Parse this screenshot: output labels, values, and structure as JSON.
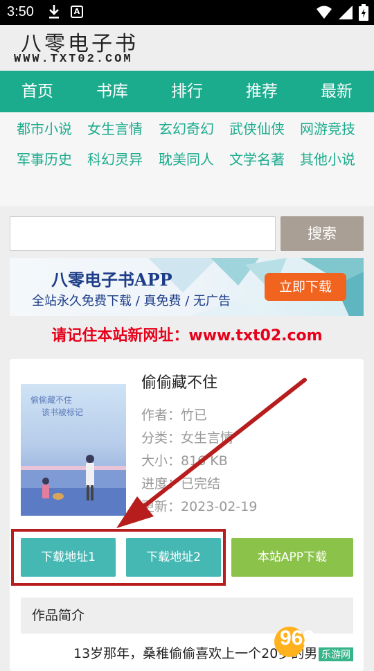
{
  "status_bar": {
    "time": "3:50",
    "a_icon": "A"
  },
  "header": {
    "logo_cn": "八零电子书",
    "logo_en": "WWW.TXT02.COM"
  },
  "nav": [
    "首页",
    "书库",
    "排行",
    "推荐",
    "最新"
  ],
  "categories": [
    "都市小说",
    "女生言情",
    "玄幻奇幻",
    "武侠仙侠",
    "网游竞技",
    "军事历史",
    "科幻灵异",
    "耽美同人",
    "文学名著",
    "其他小说"
  ],
  "search": {
    "value": "",
    "placeholder": "",
    "button": "搜索"
  },
  "banner": {
    "title": "八零电子书APP",
    "subtitle": "全站永久免费下载 / 真免费 / 无广告",
    "button": "立即下载"
  },
  "notice": "请记住本站新网址：www.txt02.com",
  "book": {
    "title": "偷偷藏不住",
    "cover_text_1": "偷偷藏不住",
    "cover_text_2": "该书被标记",
    "author": "作者：竹已",
    "category": "分类：女生言情",
    "size": "大小：816 KB",
    "progress": "进度：已完结",
    "updated": "更新：2023-02-19"
  },
  "buttons": {
    "download1": "下载地址1",
    "download2": "下载地址2",
    "app": "本站APP下载"
  },
  "intro": {
    "heading": "作品简介",
    "text": "13岁那年，桑稚偷偷喜欢上一个20岁的男"
  },
  "watermark": {
    "number": "962",
    "suffix": ".NET",
    "label": "乐游网"
  },
  "colors": {
    "nav": "#1bab8d",
    "download_btn": "#45b8b4",
    "app_btn": "#8bc34a",
    "arrow": "#b81d1d",
    "notice": "#e6001a",
    "search_btn": "#a99f94"
  }
}
